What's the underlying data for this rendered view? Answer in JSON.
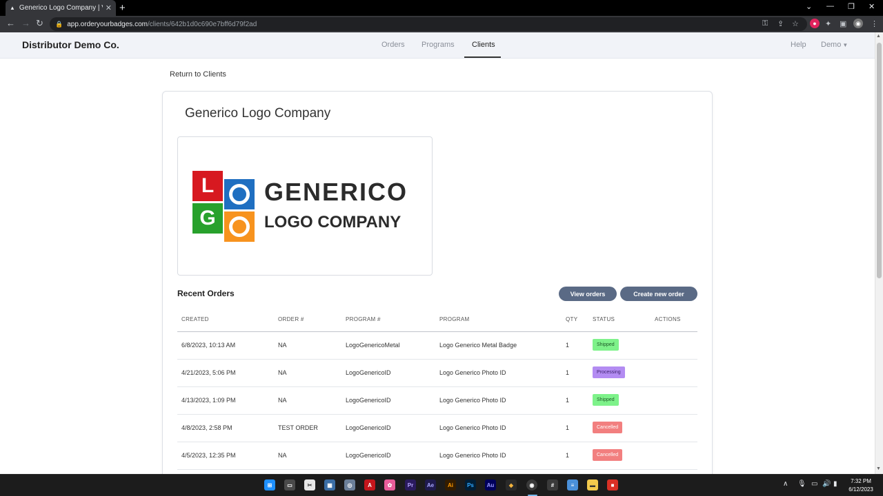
{
  "browser": {
    "tab_title": "Generico Logo Company | Vault",
    "tab_favicon": "▲",
    "close_glyph": "✕",
    "new_tab_glyph": "+",
    "url_domain": "app.orderyourbadges.com",
    "url_path": "/clients/642b1d0c690e7bff6d79f2ad"
  },
  "navbar": {
    "brand": "Distributor Demo Co.",
    "links": [
      "Orders",
      "Programs",
      "Clients"
    ],
    "active_link": "Clients",
    "help": "Help",
    "user_menu": "Demo"
  },
  "page": {
    "return_link": "Return to Clients",
    "client_name": "Generico Logo Company"
  },
  "logo": {
    "letters": [
      "L",
      "O",
      "G",
      "O"
    ],
    "word1": "GENERICO",
    "word2": "LOGO COMPANY",
    "colors": {
      "red": "#d71920",
      "blue": "#1f6fc1",
      "green": "#28a12c",
      "orange": "#f7931e"
    }
  },
  "recent_orders": {
    "title": "Recent Orders",
    "view_button": "View orders",
    "create_button": "Create new order",
    "columns": [
      "CREATED",
      "ORDER #",
      "PROGRAM #",
      "PROGRAM",
      "QTY",
      "STATUS",
      "ACTIONS"
    ],
    "rows": [
      {
        "created": "6/8/2023, 10:13 AM",
        "order": "NA",
        "program_num": "LogoGenericoMetal",
        "program": "Logo Generico Metal Badge",
        "qty": "1",
        "status": "Shipped"
      },
      {
        "created": "4/21/2023, 5:06 PM",
        "order": "NA",
        "program_num": "LogoGenericoID",
        "program": "Logo Generico Photo ID",
        "qty": "1",
        "status": "Processing"
      },
      {
        "created": "4/13/2023, 1:09 PM",
        "order": "NA",
        "program_num": "LogoGenericoID",
        "program": "Logo Generico Photo ID",
        "qty": "1",
        "status": "Shipped"
      },
      {
        "created": "4/8/2023, 2:58 PM",
        "order": "TEST ORDER",
        "program_num": "LogoGenericoID",
        "program": "Logo Generico Photo ID",
        "qty": "1",
        "status": "Cancelled"
      },
      {
        "created": "4/5/2023, 12:35 PM",
        "order": "NA",
        "program_num": "LogoGenericoID",
        "program": "Logo Generico Photo ID",
        "qty": "1",
        "status": "Cancelled"
      }
    ],
    "status_colors": {
      "Shipped": {
        "bg": "#7ef28a",
        "fg": "#1e5a28"
      },
      "Processing": {
        "bg": "#b38cf2",
        "fg": "#3e2370"
      },
      "Cancelled": {
        "bg": "#f27f7f",
        "fg": "#ffffff"
      }
    }
  },
  "taskbar": {
    "time": "7:32 PM",
    "date": "6/12/2023"
  }
}
